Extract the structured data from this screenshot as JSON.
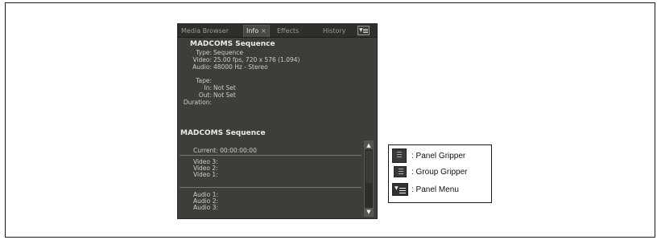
{
  "panel": {
    "tabs": [
      "Media Browser",
      "Info",
      "Effects",
      "History"
    ],
    "active_tab_close": "×",
    "info_title": "MADCOMS Sequence",
    "info_rows": [
      {
        "label": "Type:",
        "value": "Sequence"
      },
      {
        "label": "Video:",
        "value": "25.00 fps, 720 x 576 (1.094)"
      },
      {
        "label": "Audio:",
        "value": "48000 Hz - Stereo"
      },
      {
        "label": "Tape:",
        "value": ""
      },
      {
        "label": "In:",
        "value": "Not Set"
      },
      {
        "label": "Out:",
        "value": "Not Set"
      },
      {
        "label": "Duration:",
        "value": ""
      }
    ],
    "sequence_title": "MADCOMS Sequence",
    "current_label": "Current: 00:00:00:00",
    "video_tracks": [
      "Video 3:",
      "Video 2:",
      "Video 1:"
    ],
    "audio_tracks": [
      "Audio 1:",
      "Audio 2:",
      "Audio 3:"
    ]
  },
  "legend": {
    "items": [
      {
        "label": ": Panel Gripper",
        "icon": "panel-gripper-icon"
      },
      {
        "label": ": Group Gripper",
        "icon": "group-gripper-icon"
      },
      {
        "label": ": Panel Menu",
        "icon": "panel-menu-icon"
      }
    ]
  },
  "colors": {
    "panel_bg": "#3f3d3a",
    "panel_text": "#d7d5cf",
    "page_bg": "#ffffff"
  }
}
